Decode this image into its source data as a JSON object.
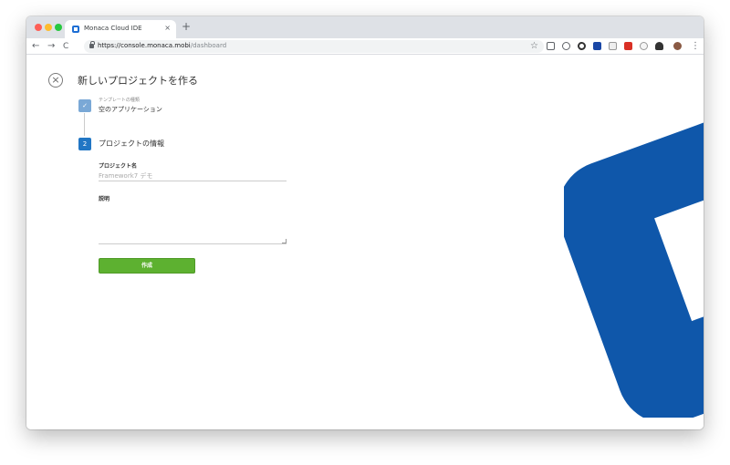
{
  "browser": {
    "tab_title": "Monaca Cloud IDE",
    "tab_close": "×",
    "new_tab": "+",
    "back": "←",
    "forward": "→",
    "reload": "C",
    "url_host": "https://console.monaca.mobi",
    "url_path": "/dashboard",
    "star": "☆"
  },
  "wizard": {
    "close_glyph": "×",
    "title": "新しいプロジェクトを作る",
    "step1": {
      "number": "✓",
      "label": "テンプレートの種類",
      "value": "空のアプリケーション"
    },
    "step2": {
      "number": "2",
      "label": "プロジェクトの情報"
    },
    "project_name_label": "プロジェクト名",
    "project_name_placeholder": "Framework7 デモ",
    "description_label": "説明",
    "description_value": "",
    "create_label": "作成"
  },
  "colors": {
    "accent_blue": "#2176c4",
    "brand_blue": "#0f57aa",
    "create_green": "#5db130"
  }
}
